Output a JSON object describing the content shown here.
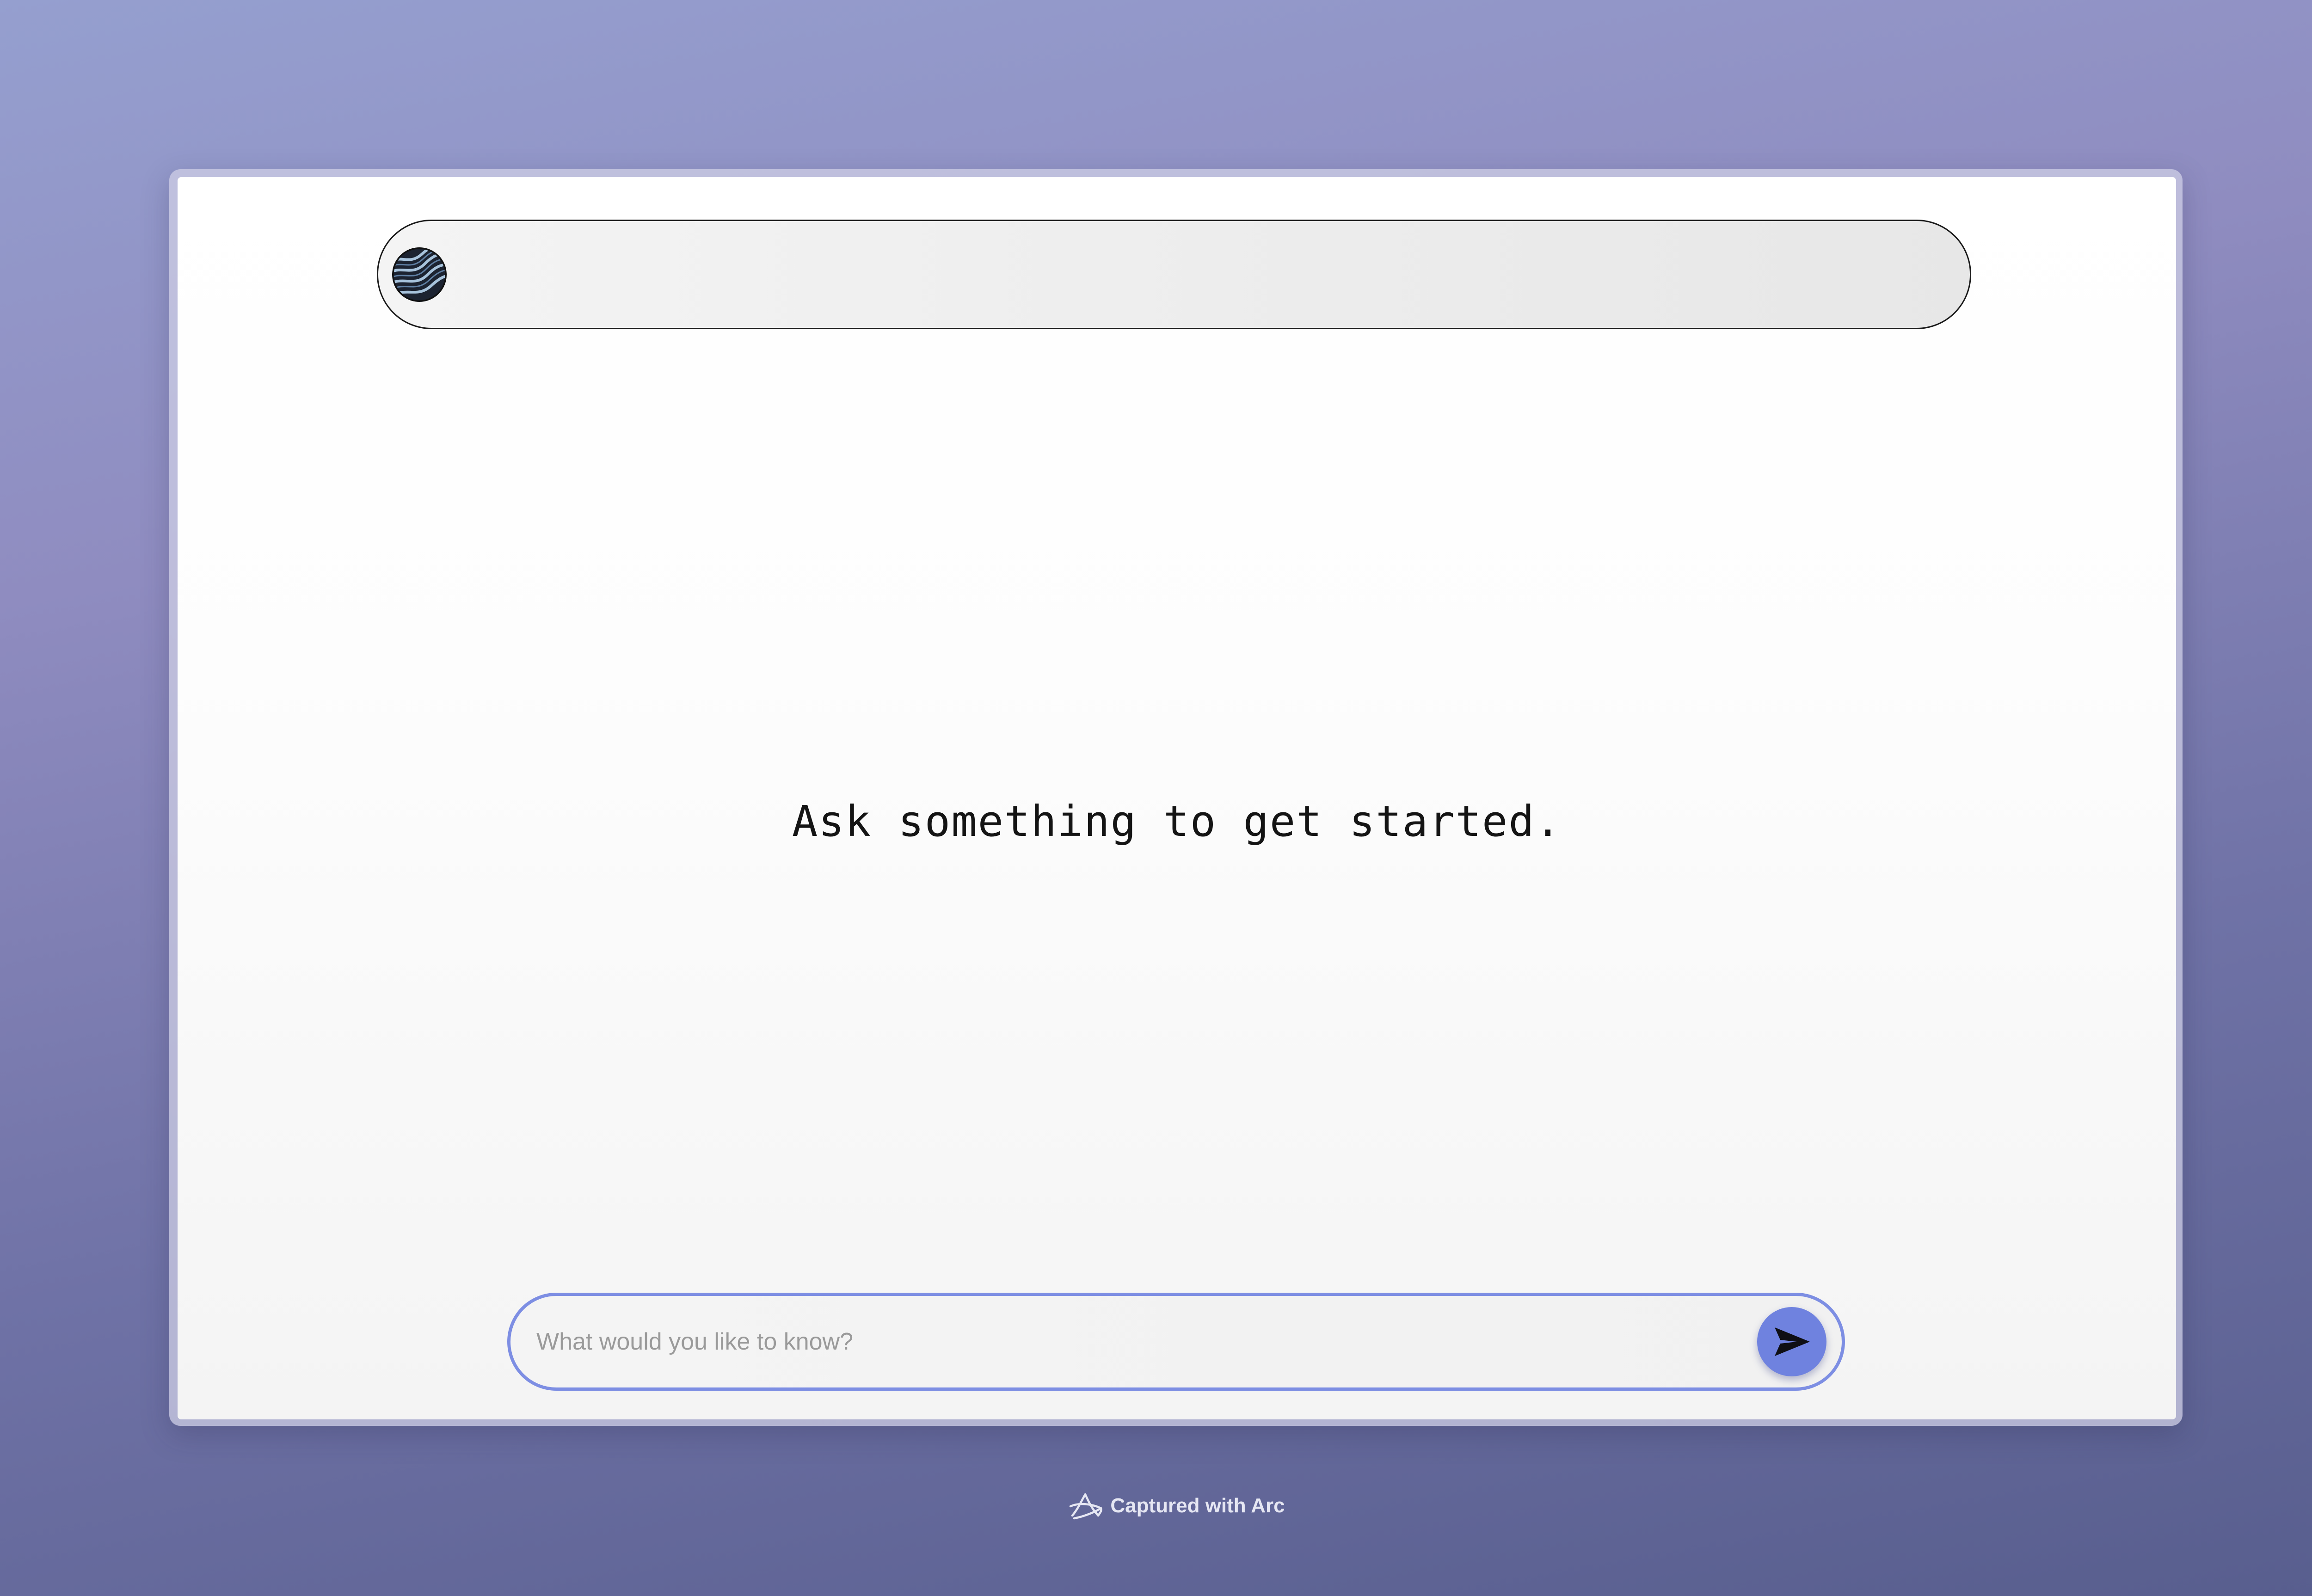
{
  "header": {
    "avatar_icon": "avatar-waves-icon"
  },
  "main": {
    "empty_prompt": "Ask something to get started."
  },
  "composer": {
    "placeholder": "What would you like to know?",
    "value": "",
    "send_icon": "send-arrow-icon",
    "accent_color": "#7d8ee3",
    "button_color": "#6f82df"
  },
  "footer": {
    "icon": "arc-logo-icon",
    "text": "Captured with Arc"
  },
  "colors": {
    "background_top": "#959fcf",
    "background_bottom": "#585e8e"
  }
}
